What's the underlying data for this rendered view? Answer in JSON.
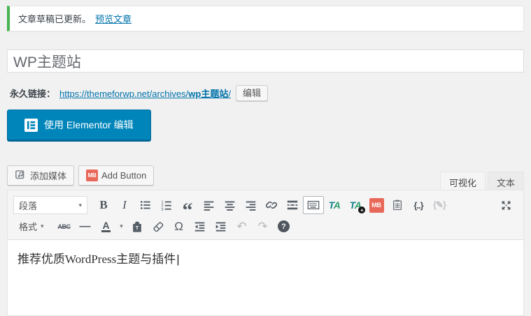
{
  "notice": {
    "message": "文章草稿已更新。",
    "preview_link": "预览文章"
  },
  "post": {
    "title": "WP主题站"
  },
  "permalink": {
    "label": "永久链接：",
    "url_prefix": "https://themeforwp.net/archives/",
    "slug": "wp主题站",
    "suffix": "/",
    "edit_label": "编辑"
  },
  "elementor": {
    "label": "使用 Elementor 编辑"
  },
  "media_row": {
    "add_media": "添加媒体",
    "add_button": "Add Button",
    "mb_badge": "MB"
  },
  "tabs": {
    "visual": "可视化",
    "text": "文本"
  },
  "toolbar": {
    "paragraph": "段落",
    "format": "格式",
    "caret": "▾",
    "bold": "B",
    "italic": "I",
    "blockquote": "“",
    "ol1": "1",
    "ol2": "2",
    "ol3": "3",
    "ta_t": "T",
    "ta_a": "A",
    "plus": "+",
    "mb": "MB",
    "shortcode": "{..}",
    "snippet_open": "{",
    "snippet_pencil": "✎",
    "snippet_close": "}",
    "strikethrough": "ABC",
    "hr": "—",
    "color_letter": "A",
    "paste_t": "T",
    "omega": "Ω",
    "undo": "↶",
    "redo": "↷",
    "help": "?"
  },
  "content": {
    "text": "推荐优质WordPress主题与插件",
    "cursor": "|"
  },
  "colors": {
    "notice_accent": "#46b450",
    "link": "#0073aa",
    "primary_button": "#0085ba",
    "mb_badge": "#e8695a",
    "ta_dark": "#15808c",
    "ta_light": "#2f9e70",
    "toolbar_icon": "#555d66"
  }
}
